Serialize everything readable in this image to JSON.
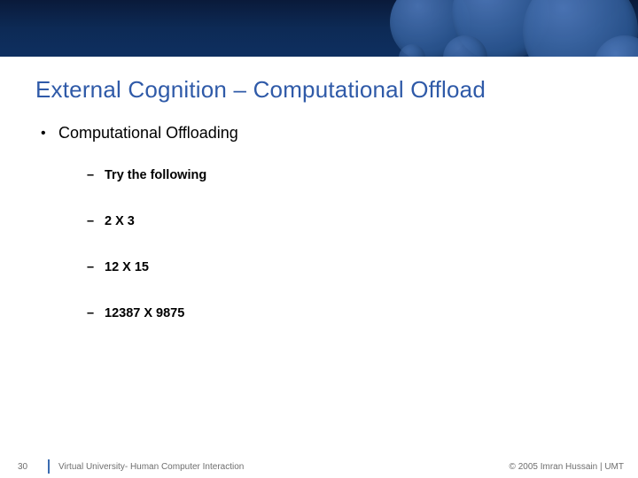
{
  "slide": {
    "title": "External Cognition – Computational Offload",
    "bullet1": "Computational Offloading",
    "sub1": "Try the following",
    "sub2": "2 X 3",
    "sub3": "12 X 15",
    "sub4": "12387 X 9875"
  },
  "footer": {
    "page": "30",
    "course": "Virtual University- Human Computer Interaction",
    "copyright": "© 2005 Imran Hussain | UMT"
  }
}
